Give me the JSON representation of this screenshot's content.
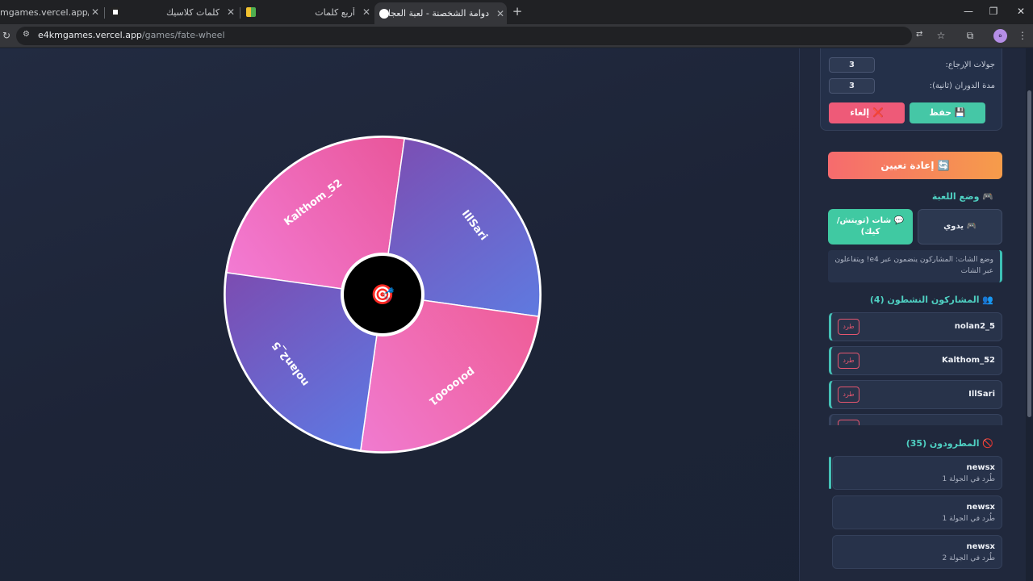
{
  "browser": {
    "tabs": [
      {
        "title": "mgames.vercel.app/games/",
        "close": "✕"
      },
      {
        "title": "كلمات كلاسيك",
        "close": "✕"
      },
      {
        "title": "أربع كلمات",
        "close": "✕"
      },
      {
        "title": "دوامة الشخصنة - لعبة العجلة وال",
        "close": "✕"
      }
    ],
    "new_tab": "+",
    "url_host": "e4kmgames.vercel.app",
    "url_path": "/games/fate-wheel",
    "profile_initial": "ه"
  },
  "wheel": {
    "segments": [
      {
        "name": "Kalthom_52",
        "color_a": "#f37bd3",
        "color_b": "#e9569a"
      },
      {
        "name": "IllSari",
        "color_a": "#7b4fb4",
        "color_b": "#5f7ae0"
      },
      {
        "name": "polooo01",
        "color_a": "#ef5d97",
        "color_b": "#f07bd0"
      },
      {
        "name": "nolan2_5",
        "color_a": "#5d79e3",
        "color_b": "#7c4cb1"
      }
    ],
    "center_icon": "target-icon",
    "center_emoji": "🎯"
  },
  "settings": {
    "rounds_label": "جولات الإرجاع:",
    "rounds_value": "3",
    "spin_label": "مدة الدوران (ثانية):",
    "spin_value": "3",
    "save_label": "💾 حفظ",
    "cancel_label": "❌ إلغاء"
  },
  "reset_label": "🔄 إعادة تعيين",
  "game_mode": {
    "title": "🎮 وضع اللعبة",
    "chat_label": "💬 شات (تويتش/كيك)",
    "manual_label": "🎮 يدوي",
    "info": "وضع الشات: المشاركون ينضمون عبر e4! ويتفاعلون عبر الشات"
  },
  "participants": {
    "title": "👥 المشاركون النشطون (4)",
    "kick_label": "طرد",
    "items": [
      {
        "name": "nolan2_5"
      },
      {
        "name": "Kalthom_52"
      },
      {
        "name": "IllSari"
      }
    ]
  },
  "kicked": {
    "title": "🚫 المطرودون (35)",
    "items": [
      {
        "name": "newsx",
        "round": "طُرد في الجولة 1"
      },
      {
        "name": "newsx",
        "round": "طُرد في الجولة 1"
      },
      {
        "name": "newsx",
        "round": "طُرد في الجولة 2"
      }
    ]
  }
}
